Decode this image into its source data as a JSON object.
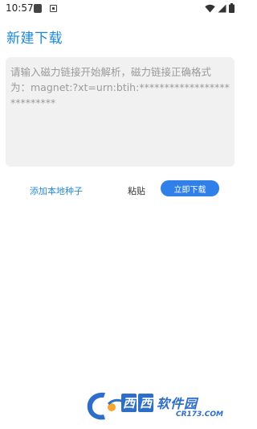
{
  "status_bar": {
    "time": "10:57",
    "icons": [
      "notification-square-icon",
      "a-icon",
      "wifi-icon",
      "signal-icon",
      "battery-icon"
    ]
  },
  "header": {
    "title": "新建下载"
  },
  "magnet_input": {
    "value": "",
    "placeholder": "请输入磁力链接开始解析，磁力链接正确格式为：magnet:?xt=urn:btih:***************************"
  },
  "actions": {
    "add_local_seed_label": "添加本地种子",
    "paste_label": "粘贴",
    "download_label": "立即下载"
  },
  "watermark": {
    "chip_1": "西",
    "chip_2": "西",
    "name": "软件园",
    "url": "CR173.COM"
  },
  "colors": {
    "title": "#1a88d9",
    "link": "#2a8ad8",
    "primary_button": "#2f80e8",
    "input_background": "#f1f1f1"
  }
}
